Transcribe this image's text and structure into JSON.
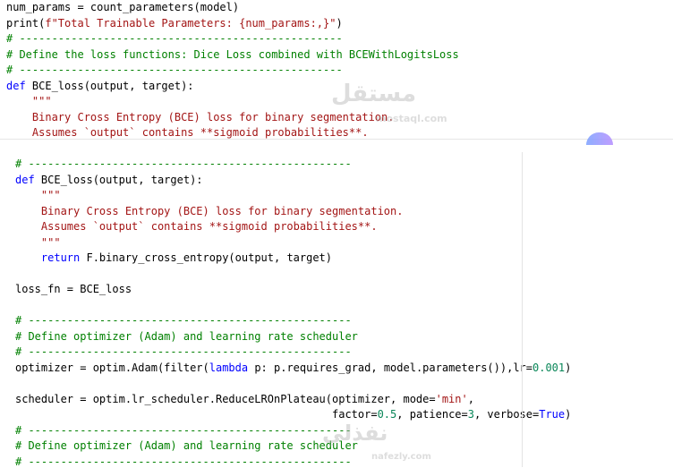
{
  "top_lines": [
    [
      {
        "t": "num_params = count_parameters(model)",
        "c": "pl"
      }
    ],
    [
      {
        "t": "print(",
        "c": "pl"
      },
      {
        "t": "f\"Total Trainable Parameters: {num_params:,}\"",
        "c": "str"
      },
      {
        "t": ")",
        "c": "pl"
      }
    ],
    [
      {
        "t": "# --------------------------------------------------",
        "c": "cmt"
      }
    ],
    [
      {
        "t": "# Define the loss functions: Dice Loss combined with BCEWithLogitsLoss",
        "c": "cmt"
      }
    ],
    [
      {
        "t": "# --------------------------------------------------",
        "c": "cmt"
      }
    ],
    [
      {
        "t": "def",
        "c": "kw"
      },
      {
        "t": " BCE_loss(output, target):",
        "c": "pl"
      }
    ],
    [
      {
        "t": "    \"\"\"",
        "c": "str"
      }
    ],
    [
      {
        "t": "    Binary Cross Entropy (BCE) loss for binary segmentation.",
        "c": "str"
      }
    ],
    [
      {
        "t": "    Assumes `output` contains **sigmoid probabilities**.",
        "c": "str"
      }
    ]
  ],
  "bottom_lines": [
    [
      {
        "t": "# --------------------------------------------------",
        "c": "cmt"
      }
    ],
    [
      {
        "t": "def",
        "c": "kw"
      },
      {
        "t": " BCE_loss(output, target):",
        "c": "pl"
      }
    ],
    [
      {
        "t": "    \"\"\"",
        "c": "str"
      }
    ],
    [
      {
        "t": "    Binary Cross Entropy (BCE) loss for binary segmentation.",
        "c": "str"
      }
    ],
    [
      {
        "t": "    Assumes `output` contains **sigmoid probabilities**.",
        "c": "str"
      }
    ],
    [
      {
        "t": "    \"\"\"",
        "c": "str"
      }
    ],
    [
      {
        "t": "    return",
        "c": "kw"
      },
      {
        "t": " F.binary_cross_entropy(output, target)",
        "c": "pl"
      }
    ],
    [],
    [
      {
        "t": "loss_fn = BCE_loss",
        "c": "pl"
      }
    ],
    [],
    [
      {
        "t": "# --------------------------------------------------",
        "c": "cmt"
      }
    ],
    [
      {
        "t": "# Define optimizer (Adam) and learning rate scheduler",
        "c": "cmt"
      }
    ],
    [
      {
        "t": "# --------------------------------------------------",
        "c": "cmt"
      }
    ],
    [
      {
        "t": "optimizer = optim.Adam(filter(",
        "c": "pl"
      },
      {
        "t": "lambda",
        "c": "kw"
      },
      {
        "t": " p: p.requires_grad, model.parameters()),lr=",
        "c": "pl"
      },
      {
        "t": "0.001",
        "c": "num"
      },
      {
        "t": ")",
        "c": "pl"
      }
    ],
    [],
    [
      {
        "t": "scheduler = optim.lr_scheduler.ReduceLROnPlateau(optimizer, mode=",
        "c": "pl"
      },
      {
        "t": "'min'",
        "c": "str"
      },
      {
        "t": ",",
        "c": "pl"
      }
    ],
    [
      {
        "t": "                                                 factor=",
        "c": "pl"
      },
      {
        "t": "0.5",
        "c": "num"
      },
      {
        "t": ", patience=",
        "c": "pl"
      },
      {
        "t": "3",
        "c": "num"
      },
      {
        "t": ", verbose=",
        "c": "pl"
      },
      {
        "t": "True",
        "c": "kw"
      },
      {
        "t": ")",
        "c": "pl"
      }
    ],
    [
      {
        "t": "# --------------------------------------------------",
        "c": "cmt"
      }
    ],
    [
      {
        "t": "# Define optimizer (Adam) and learning rate scheduler",
        "c": "cmt"
      }
    ],
    [
      {
        "t": "# --------------------------------------------------",
        "c": "cmt"
      }
    ]
  ],
  "watermark": {
    "mostaql_ar": "مستقل",
    "mostaql_en": "mostaql.com",
    "nafezly_ar": "نفذلي",
    "nafezly_en": "nafezly.com"
  },
  "colors": {
    "keyword": "#0000ff",
    "string": "#a31515",
    "comment": "#008000",
    "number": "#098658"
  }
}
